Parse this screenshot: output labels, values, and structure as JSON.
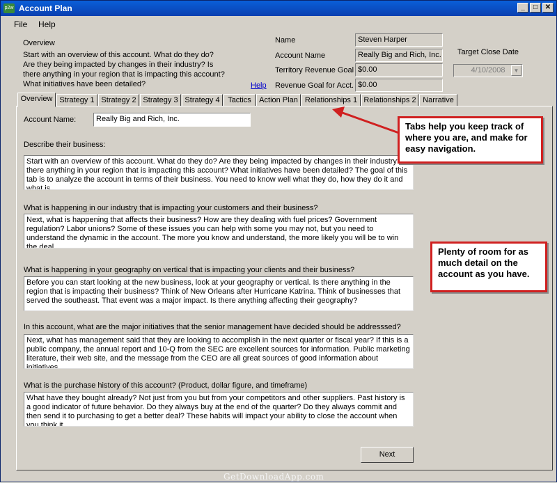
{
  "window": {
    "icon_text": "p2w",
    "title": "Account Plan",
    "controls": [
      "_",
      "□",
      "✕"
    ]
  },
  "menu": [
    "File",
    "Help"
  ],
  "overview": {
    "title": "Overview",
    "lines": [
      "Start with an overview of this account.  What do they do?",
      "Are they being impacted by changes in their industry? Is",
      "there anything in your region that is impacting this account?",
      "What initiatives have been detailed?"
    ],
    "help_label": "Help"
  },
  "fields": {
    "name_label": "Name",
    "name_value": "Steven Harper",
    "account_label": "Account Name",
    "account_value": "Really Big and Rich, Inc.",
    "territory_label": "Territory Revenue Goal",
    "territory_value": "$0.00",
    "goal_label": "Revenue Goal for Acct.",
    "goal_value": "$0.00"
  },
  "target_close": {
    "label": "Target Close Date",
    "value": "4/10/2008"
  },
  "tabs": [
    "Overview",
    "Strategy 1",
    "Strategy 2",
    "Strategy 3",
    "Strategy 4",
    "Tactics",
    "Action Plan",
    "Relationships 1",
    "Relationships 2",
    "Narrative"
  ],
  "panel": {
    "account_name_label": "Account Name:",
    "account_name_value": "Really Big and Rich, Inc.",
    "sections": [
      {
        "label": "Describe their business:",
        "text": "Start with an overview of this account. What do they do? Are they being impacted by changes in their industry? Is there anything in your region that is impacting this account? What initiatives have been detailed?  The goal of this tab is to analyze the account in terms of their business. You need to know well what they do, how they do it and what is"
      },
      {
        "label": "What is happening in our industry that is impacting your customers and their business?",
        "text": "Next, what is happening that affects their business? How are they dealing with fuel prices? Government regulation? Labor unions? Some of these issues you can help with some you may not, but you need to understand the dynamic in the account. The more you know and understand, the more likely you will be to win the deal."
      },
      {
        "label": "What is happening in your geography on vertical that is impacting your clients and their business?",
        "text": "Before you can start looking at the new business, look at your geography or vertical. Is there anything in the region that is impacting their business? Think of New Orleans after Hurricane Katrina. Think of businesses that served the southeast. That event was a major impact. Is there anything affecting their geography?"
      },
      {
        "label": "In this account, what are the major initiatives that the senior management have decided should be addresssed?",
        "text": "Next, what has management said that they are looking to accomplish in the next quarter or fiscal year? If this is a public company, the annual report and 10-Q from the SEC are excellent sources for information. Public marketing literature, their web site, and the message from the CEO are all great sources of good information about initiatives."
      },
      {
        "label": "What is the purchase history of this account?  (Product, dollar figure, and timeframe)",
        "text": "What have they bought already? Not just from you but from your competitors and other suppliers. Past history is a good indicator of future behavior. Do they always buy at the end of the quarter? Do they always commit and then send it to purchasing to get a better deal? These habits will impact your ability to close the account when you think it"
      }
    ],
    "next_label": "Next"
  },
  "callouts": {
    "tabs": "Tabs help you keep track of where you are, and make for easy navigation.",
    "room": "Plenty of room for as much detail on the account as you have."
  },
  "watermark": "GetDownloadApp.com"
}
